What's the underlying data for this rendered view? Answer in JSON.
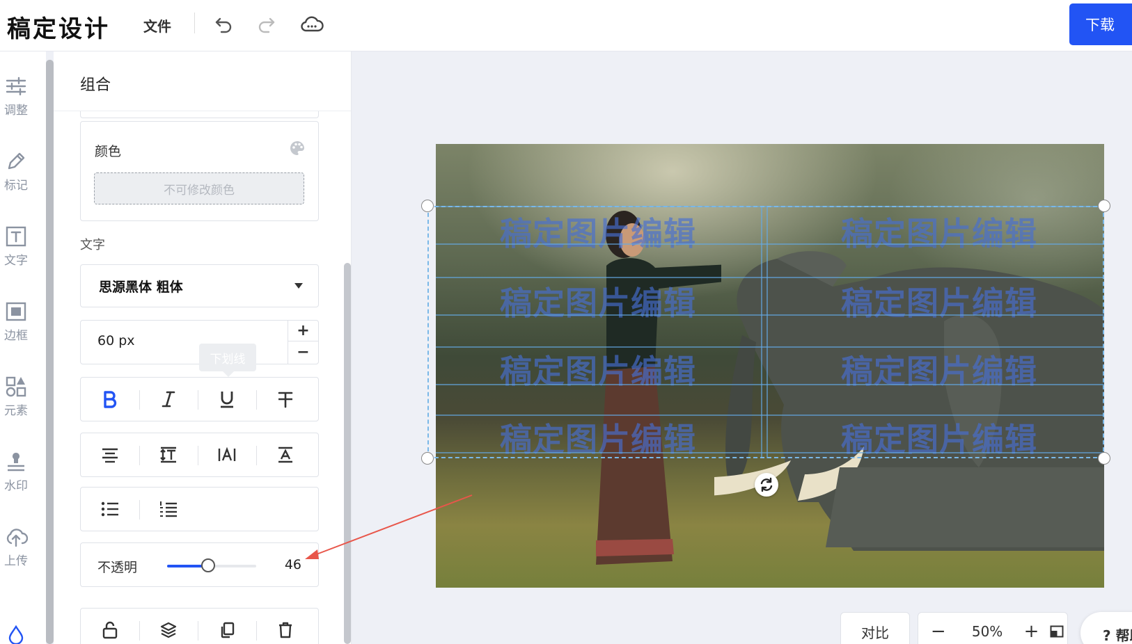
{
  "app": {
    "title": "稿定设计",
    "file_menu": "文件",
    "download": "下载"
  },
  "topbar_icons": [
    "undo-icon",
    "redo-icon",
    "cloud-save-icon"
  ],
  "leftnav": {
    "items": [
      {
        "label": "调整",
        "icon": "sliders-icon"
      },
      {
        "label": "标记",
        "icon": "pen-icon"
      },
      {
        "label": "文字",
        "icon": "text-icon"
      },
      {
        "label": "边框",
        "icon": "frame-icon"
      },
      {
        "label": "元素",
        "icon": "elements-icon"
      },
      {
        "label": "水印",
        "icon": "watermark-icon"
      },
      {
        "label": "上传",
        "icon": "upload-cloud-icon"
      }
    ]
  },
  "panel": {
    "title": "组合",
    "color_section": {
      "label": "颜色",
      "disabled_text": "不可修改颜色"
    },
    "text_section": {
      "label": "文字",
      "font_family": "思源黑体 粗体",
      "font_size": "60 px",
      "tooltip": "下划线"
    },
    "opacity": {
      "label": "不透明",
      "value": "46",
      "fraction": 0.46
    }
  },
  "canvas": {
    "watermark_text": "稿定图片编辑",
    "zoom": "50%",
    "compare": "对比",
    "help": "? 帮助"
  },
  "colors": {
    "accent": "#2254f4",
    "selection": "#7ab8e8",
    "annotation_arrow": "#e8564a"
  }
}
